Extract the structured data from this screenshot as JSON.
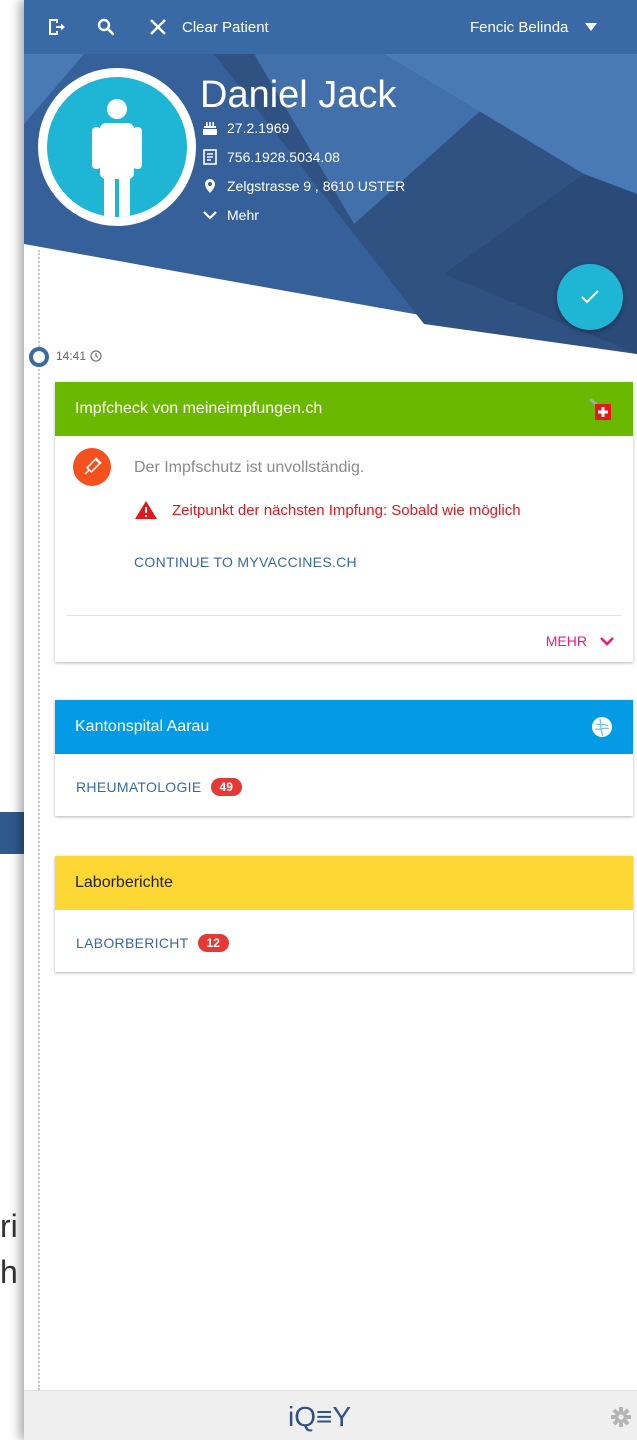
{
  "topbar": {
    "clear_label": "Clear Patient",
    "user_name": "Fencic Belinda"
  },
  "patient": {
    "name": "Daniel Jack",
    "birthdate": "27.2.1969",
    "ssn": "756.1928.5034.08",
    "address": "Zelgstrasse 9 , 8610 USTER",
    "more_label": "Mehr"
  },
  "timeline": {
    "time": "14:41"
  },
  "cards": {
    "vaccine": {
      "title": "Impfcheck von meineimpfungen.ch",
      "status": "Der Impfschutz ist unvollständig.",
      "warning": "Zeitpunkt der nächsten Impfung: Sobald wie möglich",
      "link": "CONTINUE TO MYVACCINES.CH",
      "more": "MEHR"
    },
    "hospital": {
      "title": "Kantonspital Aarau",
      "link": "RHEUMATOLOGIE",
      "count": "49"
    },
    "lab": {
      "title": "Laborberichte",
      "link": "LABORBERICHT",
      "count": "12"
    }
  },
  "footer": {
    "logo": "iQ≡Y"
  },
  "background": {
    "line1": "ri",
    "line2": "h"
  },
  "colors": {
    "topbar": "#3a6aa6",
    "header_dark": "#2f5283",
    "accent_cyan": "#1fb5d4",
    "vaccine_green": "#6ab800",
    "hospital_blue": "#039be5",
    "lab_yellow": "#fdd835",
    "warning_red": "#e8151b",
    "link_blue": "#3a6aa6",
    "more_pink": "#e91e78"
  }
}
